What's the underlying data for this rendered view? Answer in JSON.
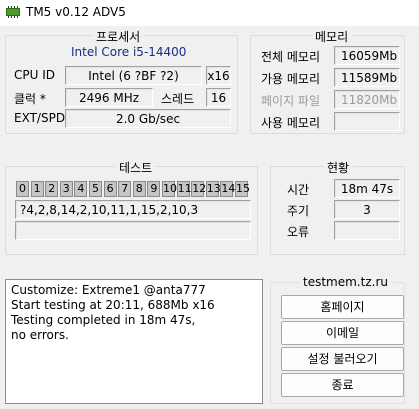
{
  "window": {
    "title": "TM5 v0.12 ADV5"
  },
  "processor": {
    "title": "프로세서",
    "cpu_name": "Intel Core i5-14400",
    "cpu_id_label": "CPU ID",
    "cpu_id_value": "Intel  (6 ?BF ?2)",
    "cpu_id_extra": "x16",
    "clock_label": "클럭 *",
    "clock_value": "2496 MHz",
    "threads_label": "스레드",
    "threads_value": "16",
    "ext_label": "EXT/SPD",
    "ext_value": "2.0 Gb/sec"
  },
  "memory": {
    "title": "메모리",
    "total_label": "전체 메모리",
    "total_value": "16059Mb",
    "available_label": "가용 메모리",
    "available_value": "11589Mb",
    "pagefile_label": "페이지 파일",
    "pagefile_value": "11820Mb",
    "used_label": "사용 메모리",
    "used_value": ""
  },
  "tests": {
    "title": "테스트",
    "cells": [
      "0",
      "1",
      "2",
      "3",
      "4",
      "5",
      "6",
      "7",
      "8",
      "9",
      "10",
      "11",
      "12",
      "13",
      "14",
      "15"
    ],
    "sequence": "?4,2,8,14,2,10,11,1,15,2,10,3",
    "extra": ""
  },
  "status": {
    "title": "현황",
    "time_label": "시간",
    "time_value": "18m 47s",
    "cycle_label": "주기",
    "cycle_value": "3",
    "errors_label": "오류",
    "errors_value": ""
  },
  "log": {
    "lines": [
      "Customize: Extreme1 @anta777",
      "Start testing at 20:11, 688Mb x16",
      "Testing completed in 18m 47s,",
      "no errors."
    ]
  },
  "links": {
    "site": "testmem.tz.ru",
    "homepage": "홈페이지",
    "email": "이메일",
    "load_config": "설정 불러오기",
    "exit": "종료"
  }
}
